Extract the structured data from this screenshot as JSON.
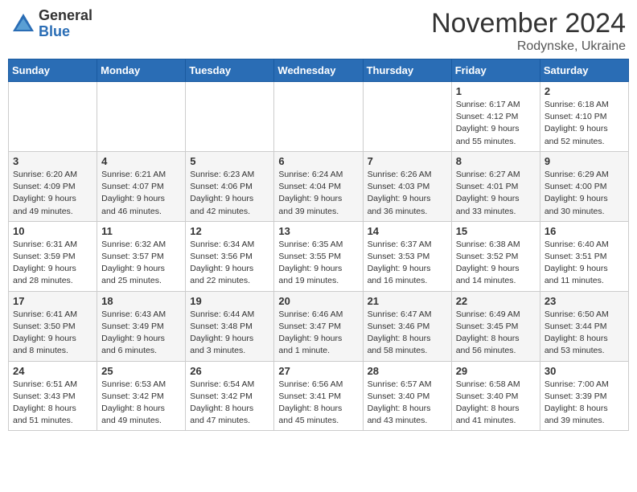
{
  "logo": {
    "general": "General",
    "blue": "Blue"
  },
  "title": "November 2024",
  "location": "Rodynske, Ukraine",
  "days_header": [
    "Sunday",
    "Monday",
    "Tuesday",
    "Wednesday",
    "Thursday",
    "Friday",
    "Saturday"
  ],
  "weeks": [
    [
      {
        "day": "",
        "info": ""
      },
      {
        "day": "",
        "info": ""
      },
      {
        "day": "",
        "info": ""
      },
      {
        "day": "",
        "info": ""
      },
      {
        "day": "",
        "info": ""
      },
      {
        "day": "1",
        "info": "Sunrise: 6:17 AM\nSunset: 4:12 PM\nDaylight: 9 hours\nand 55 minutes."
      },
      {
        "day": "2",
        "info": "Sunrise: 6:18 AM\nSunset: 4:10 PM\nDaylight: 9 hours\nand 52 minutes."
      }
    ],
    [
      {
        "day": "3",
        "info": "Sunrise: 6:20 AM\nSunset: 4:09 PM\nDaylight: 9 hours\nand 49 minutes."
      },
      {
        "day": "4",
        "info": "Sunrise: 6:21 AM\nSunset: 4:07 PM\nDaylight: 9 hours\nand 46 minutes."
      },
      {
        "day": "5",
        "info": "Sunrise: 6:23 AM\nSunset: 4:06 PM\nDaylight: 9 hours\nand 42 minutes."
      },
      {
        "day": "6",
        "info": "Sunrise: 6:24 AM\nSunset: 4:04 PM\nDaylight: 9 hours\nand 39 minutes."
      },
      {
        "day": "7",
        "info": "Sunrise: 6:26 AM\nSunset: 4:03 PM\nDaylight: 9 hours\nand 36 minutes."
      },
      {
        "day": "8",
        "info": "Sunrise: 6:27 AM\nSunset: 4:01 PM\nDaylight: 9 hours\nand 33 minutes."
      },
      {
        "day": "9",
        "info": "Sunrise: 6:29 AM\nSunset: 4:00 PM\nDaylight: 9 hours\nand 30 minutes."
      }
    ],
    [
      {
        "day": "10",
        "info": "Sunrise: 6:31 AM\nSunset: 3:59 PM\nDaylight: 9 hours\nand 28 minutes."
      },
      {
        "day": "11",
        "info": "Sunrise: 6:32 AM\nSunset: 3:57 PM\nDaylight: 9 hours\nand 25 minutes."
      },
      {
        "day": "12",
        "info": "Sunrise: 6:34 AM\nSunset: 3:56 PM\nDaylight: 9 hours\nand 22 minutes."
      },
      {
        "day": "13",
        "info": "Sunrise: 6:35 AM\nSunset: 3:55 PM\nDaylight: 9 hours\nand 19 minutes."
      },
      {
        "day": "14",
        "info": "Sunrise: 6:37 AM\nSunset: 3:53 PM\nDaylight: 9 hours\nand 16 minutes."
      },
      {
        "day": "15",
        "info": "Sunrise: 6:38 AM\nSunset: 3:52 PM\nDaylight: 9 hours\nand 14 minutes."
      },
      {
        "day": "16",
        "info": "Sunrise: 6:40 AM\nSunset: 3:51 PM\nDaylight: 9 hours\nand 11 minutes."
      }
    ],
    [
      {
        "day": "17",
        "info": "Sunrise: 6:41 AM\nSunset: 3:50 PM\nDaylight: 9 hours\nand 8 minutes."
      },
      {
        "day": "18",
        "info": "Sunrise: 6:43 AM\nSunset: 3:49 PM\nDaylight: 9 hours\nand 6 minutes."
      },
      {
        "day": "19",
        "info": "Sunrise: 6:44 AM\nSunset: 3:48 PM\nDaylight: 9 hours\nand 3 minutes."
      },
      {
        "day": "20",
        "info": "Sunrise: 6:46 AM\nSunset: 3:47 PM\nDaylight: 9 hours\nand 1 minute."
      },
      {
        "day": "21",
        "info": "Sunrise: 6:47 AM\nSunset: 3:46 PM\nDaylight: 8 hours\nand 58 minutes."
      },
      {
        "day": "22",
        "info": "Sunrise: 6:49 AM\nSunset: 3:45 PM\nDaylight: 8 hours\nand 56 minutes."
      },
      {
        "day": "23",
        "info": "Sunrise: 6:50 AM\nSunset: 3:44 PM\nDaylight: 8 hours\nand 53 minutes."
      }
    ],
    [
      {
        "day": "24",
        "info": "Sunrise: 6:51 AM\nSunset: 3:43 PM\nDaylight: 8 hours\nand 51 minutes."
      },
      {
        "day": "25",
        "info": "Sunrise: 6:53 AM\nSunset: 3:42 PM\nDaylight: 8 hours\nand 49 minutes."
      },
      {
        "day": "26",
        "info": "Sunrise: 6:54 AM\nSunset: 3:42 PM\nDaylight: 8 hours\nand 47 minutes."
      },
      {
        "day": "27",
        "info": "Sunrise: 6:56 AM\nSunset: 3:41 PM\nDaylight: 8 hours\nand 45 minutes."
      },
      {
        "day": "28",
        "info": "Sunrise: 6:57 AM\nSunset: 3:40 PM\nDaylight: 8 hours\nand 43 minutes."
      },
      {
        "day": "29",
        "info": "Sunrise: 6:58 AM\nSunset: 3:40 PM\nDaylight: 8 hours\nand 41 minutes."
      },
      {
        "day": "30",
        "info": "Sunrise: 7:00 AM\nSunset: 3:39 PM\nDaylight: 8 hours\nand 39 minutes."
      }
    ]
  ]
}
